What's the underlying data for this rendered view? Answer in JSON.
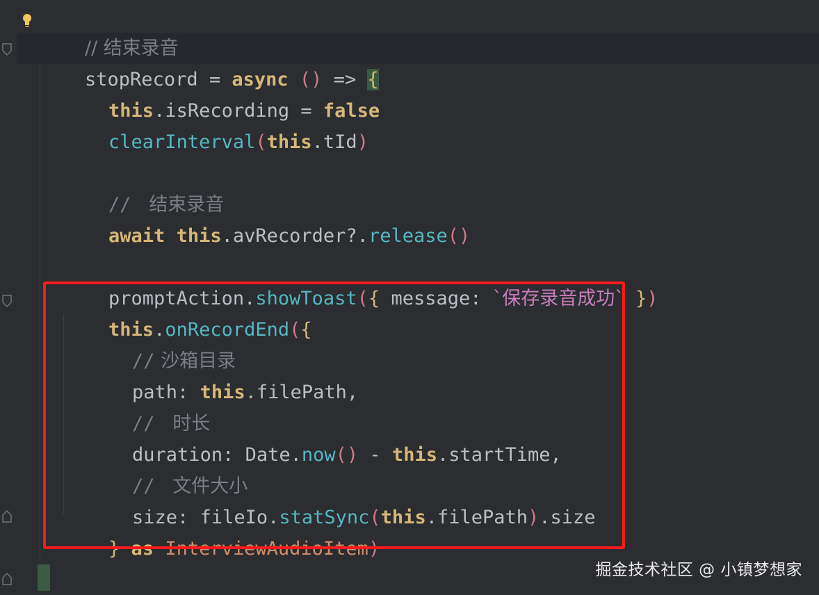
{
  "editor": {
    "lines": {
      "l1_comment": "// 结束录音",
      "l2_name": "stopRecord",
      "l2_eq": " = ",
      "l2_async": "async",
      "l2_sp": " ",
      "l2_parens": "()",
      "l2_arrow": " => ",
      "l2_brace": "{",
      "l3_this": "this",
      "l3_rest": ".isRecording = ",
      "l3_false": "false",
      "l4_fn": "clearInterval",
      "l4_po": "(",
      "l4_this": "this",
      "l4_rest": ".tId",
      "l4_pc": ")",
      "l6_comment_slash": "//",
      "l6_comment_text": "   结束录音",
      "l7_await": "await",
      "l7_sp": " ",
      "l7_this": "this",
      "l7_rest": ".avRecorder?.",
      "l7_fn": "release",
      "l7_parens": "()",
      "l9_obj": "promptAction.",
      "l9_fn": "showToast",
      "l9_po": "(",
      "l9_bo": "{",
      "l9_key": " message: ",
      "l9_str": "`保存录音成功`",
      "l9_bc": " }",
      "l9_pc": ")",
      "l10_this": "this",
      "l10_dot": ".",
      "l10_fn": "onRecordEnd",
      "l10_po": "(",
      "l10_bo": "{",
      "l11_slash": "//",
      "l11_text": " 沙箱目录",
      "l12_key": "path: ",
      "l12_this": "this",
      "l12_rest": ".filePath,",
      "l13_slash": "//",
      "l13_text": "   时长",
      "l14_key": "duration: Date.",
      "l14_fn": "now",
      "l14_parens": "()",
      "l14_minus": " - ",
      "l14_this": "this",
      "l14_rest": ".startTime,",
      "l15_slash": "//",
      "l15_text": "   文件大小",
      "l16_key": "size: fileIo.",
      "l16_fn": "statSync",
      "l16_po": "(",
      "l16_this": "this",
      "l16_rest": ".filePath",
      "l16_pc": ")",
      "l16_tail": ".size",
      "l17_bc": "}",
      "l17_as": " as ",
      "l17_type": "InterviewAudioItem",
      "l17_pc": ")",
      "l19_brace": "}"
    },
    "watermark": "掘金技术社区 @ 小镇梦想家",
    "accent_highlight": "#ff1a1a"
  }
}
